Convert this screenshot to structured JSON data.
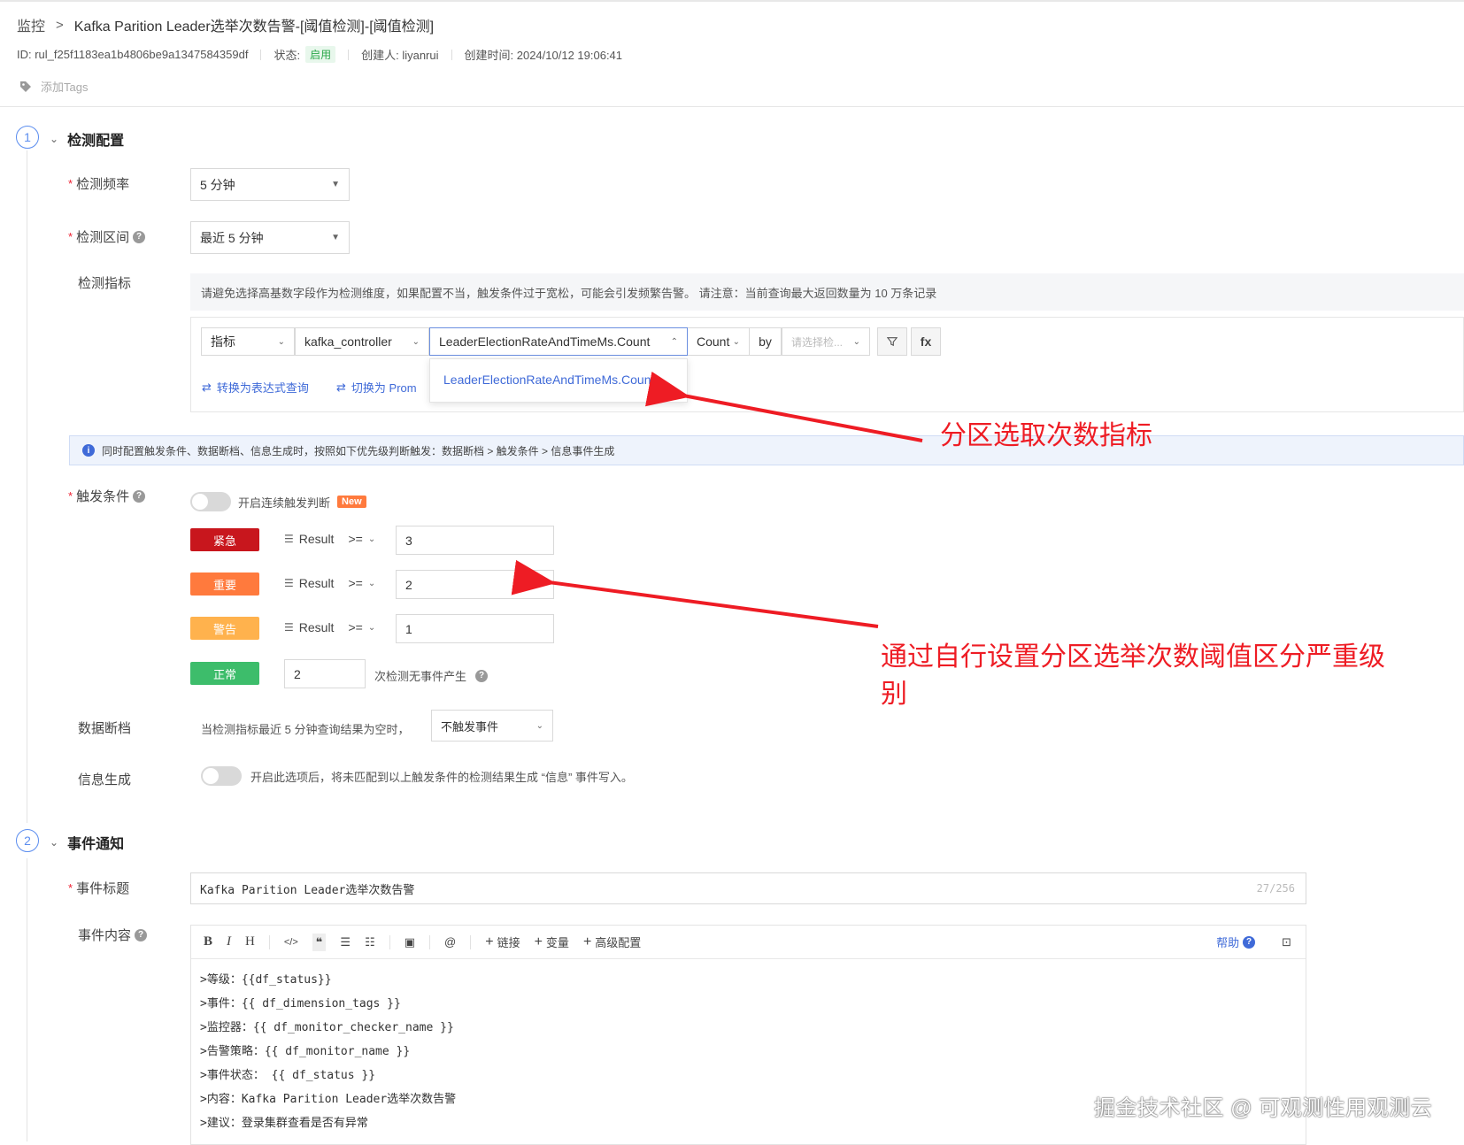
{
  "breadcrumb": {
    "home": "监控",
    "sep": ">",
    "title": "Kafka Parition Leader选举次数告警-[阈值检测]-[阈值检测]"
  },
  "meta": {
    "id": "ID: rul_f25f1183ea1b4806be9a1347584359df",
    "status_label": "状态:",
    "status_value": "启用",
    "creator": "创建人: liyanrui",
    "created_at": "创建时间: 2024/10/12 19:06:41"
  },
  "tags": {
    "add_label": "添加Tags"
  },
  "section1": {
    "step": "1",
    "title": "检测配置"
  },
  "freq": {
    "label": "检测频率",
    "value": "5 分钟"
  },
  "range": {
    "label": "检测区间",
    "value": "最近 5 分钟"
  },
  "metric": {
    "label": "检测指标",
    "tip": "请避免选择高基数字段作为检测维度，如果配置不当，触发条件过于宽松，可能会引发频繁告警。 请注意：当前查询最大返回数量为 10 万条记录",
    "type": "指标",
    "measurement": "kafka_controller",
    "field": "LeaderElectionRateAndTimeMs.Count",
    "agg": "Count",
    "by": "by",
    "by_placeholder": "请选择检...",
    "fx": "fx",
    "convert_expr": "转换为表达式查询",
    "switch_prom": "切换为 Prom",
    "dropdown_item": "LeaderElectionRateAndTimeMs.Count"
  },
  "info_bar": "同时配置触发条件、数据断档、信息生成时，按照如下优先级判断触发：数据断档 > 触发条件 > 信息事件生成",
  "trigger": {
    "label": "触发条件",
    "continuous": "开启连续触发判断",
    "new": "New",
    "rows": [
      {
        "level": "紧急",
        "color": "#c8161d",
        "field": "Result",
        "op": ">=",
        "value": "3"
      },
      {
        "level": "重要",
        "color": "#ff7a3d",
        "field": "Result",
        "op": ">=",
        "value": "2"
      },
      {
        "level": "警告",
        "color": "#ffb24d",
        "field": "Result",
        "op": ">=",
        "value": "1"
      }
    ],
    "normal": {
      "level": "正常",
      "color": "#3dbd6b",
      "value": "2",
      "suffix": "次检测无事件产生"
    }
  },
  "nodata": {
    "label": "数据断档",
    "text": "当检测指标最近 5 分钟查询结果为空时，",
    "value": "不触发事件"
  },
  "infogen": {
    "label": "信息生成",
    "text": "开启此选项后，将未匹配到以上触发条件的检测结果生成 “信息” 事件写入。"
  },
  "section2": {
    "step": "2",
    "title": "事件通知"
  },
  "event_title": {
    "label": "事件标题",
    "value": "Kafka Parition Leader选举次数告警",
    "count": "27/256"
  },
  "event_content": {
    "label": "事件内容",
    "toolbar": {
      "bold": "B",
      "italic": "I",
      "heading": "H",
      "link": "链接",
      "var": "变量",
      "advanced": "高级配置",
      "help": "帮助",
      "at": "@"
    },
    "lines": [
      ">等级：{{df_status}}",
      ">事件：{{ df_dimension_tags }}",
      ">监控器：{{ df_monitor_checker_name }}",
      ">告警策略：{{ df_monitor_name }}",
      ">事件状态： {{ df_status }}",
      ">内容：Kafka Parition Leader选举次数告警",
      ">建议：登录集群查看是否有异常"
    ]
  },
  "annotations": {
    "a1": "分区选取次数指标",
    "a2_line1": "通过自行设置分区选举次数阈值区分严重级",
    "a2_line2": "别"
  },
  "watermark": "掘金技术社区 @ 可观测性用观测云"
}
